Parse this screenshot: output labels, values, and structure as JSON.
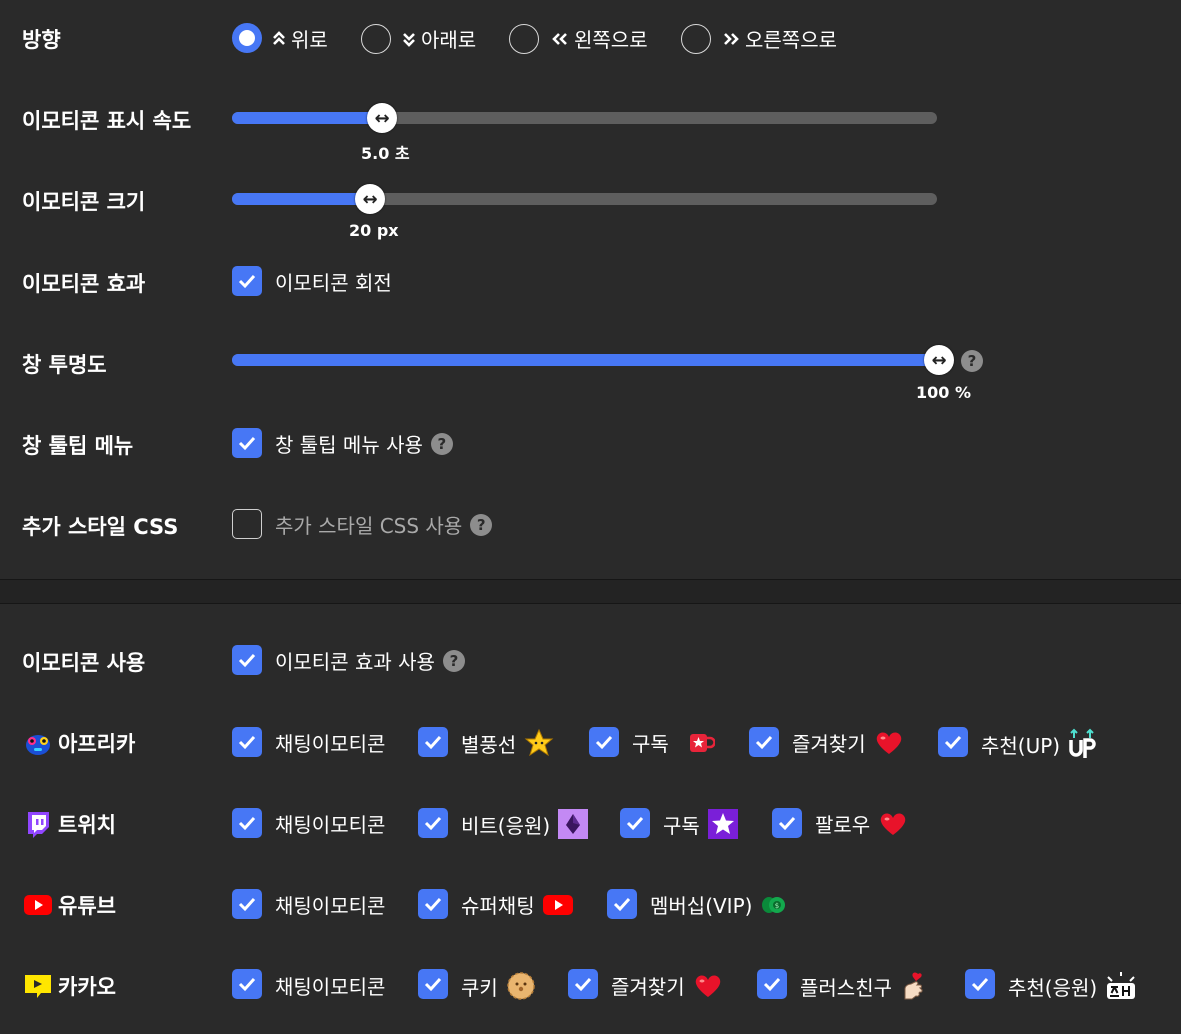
{
  "settings": {
    "direction": {
      "label": "방향",
      "options": [
        {
          "label": "위로",
          "arrow": "⌃⌃",
          "selected": true
        },
        {
          "label": "아래로",
          "arrow": "⌄⌄",
          "selected": false
        },
        {
          "label": "왼쪽으로",
          "arrow": "«",
          "selected": false
        },
        {
          "label": "오른쪽으로",
          "arrow": "»",
          "selected": false
        }
      ]
    },
    "display_speed": {
      "label": "이모티콘 표시 속도",
      "value": "5.0 초",
      "fraction": 0.21
    },
    "size": {
      "label": "이모티콘 크기",
      "value": "20 px",
      "fraction": 0.195
    },
    "effect": {
      "label": "이모티콘 효과",
      "option_label": "이모티콘 회전",
      "checked": true
    },
    "opacity": {
      "label": "창 투명도",
      "value": "100 %",
      "fraction": 1.0
    },
    "tooltip": {
      "label": "창 툴팁 메뉴",
      "option_label": "창 툴팁 메뉴 사용",
      "checked": true
    },
    "custom_css": {
      "label": "추가 스타일 CSS",
      "option_label": "추가 스타일 CSS 사용",
      "checked": false
    }
  },
  "platforms": {
    "emoticon_use": {
      "label": "이모티콘 사용",
      "option_label": "이모티콘 효과 사용",
      "checked": true
    },
    "afreeca": {
      "label": "아프리카",
      "icon": "afreeca-logo-icon",
      "options": [
        {
          "label": "채팅이모티콘",
          "icon": ""
        },
        {
          "label": "별풍선",
          "icon": "star-balloon-icon"
        },
        {
          "label": "구독",
          "icon": "subscribe-mug-icon"
        },
        {
          "label": "즐겨찾기",
          "icon": "heart-icon"
        },
        {
          "label": "추천(UP)",
          "icon": "up-icon"
        }
      ]
    },
    "twitch": {
      "label": "트위치",
      "icon": "twitch-logo-icon",
      "options": [
        {
          "label": "채팅이모티콘",
          "icon": ""
        },
        {
          "label": "비트(응원)",
          "icon": "bits-icon"
        },
        {
          "label": "구독",
          "icon": "sub-star-icon"
        },
        {
          "label": "팔로우",
          "icon": "heart-icon"
        }
      ]
    },
    "youtube": {
      "label": "유튜브",
      "icon": "youtube-logo-icon",
      "options": [
        {
          "label": "채팅이모티콘",
          "icon": ""
        },
        {
          "label": "슈퍼채팅",
          "icon": "youtube-icon"
        },
        {
          "label": "멤버십(VIP)",
          "icon": "money-icon"
        }
      ]
    },
    "kakao": {
      "label": "카카오",
      "icon": "kakaotv-logo-icon",
      "options": [
        {
          "label": "채팅이모티콘",
          "icon": ""
        },
        {
          "label": "쿠키",
          "icon": "cookie-icon"
        },
        {
          "label": "즐겨찾기",
          "icon": "heart-icon"
        },
        {
          "label": "플러스친구",
          "icon": "finger-heart-icon"
        },
        {
          "label": "추천(응원)",
          "icon": "cheer-text-icon"
        }
      ]
    }
  },
  "colors": {
    "accent": "#4777f5",
    "background": "#2a2a2a",
    "track": "#5e5e5e",
    "heart": "#e8132a",
    "youtube_red": "#ff0000",
    "twitch_purple": "#9146ff"
  }
}
